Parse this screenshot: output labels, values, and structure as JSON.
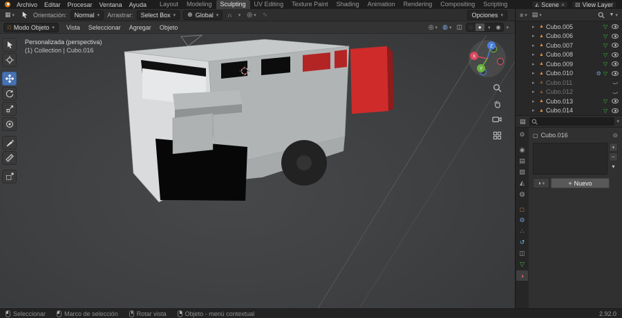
{
  "icons": {
    "chevron": "▾",
    "expand": "▸",
    "mesh_object": "▲",
    "mesh_data": "▽",
    "gear": "⚙",
    "magnet": "∩",
    "global_axis": "⊕",
    "prop_edit": "◎",
    "falloff": "∿",
    "menu": "≡",
    "editor_grid": "▦",
    "display_mode": "▤",
    "funnel": "▼",
    "gizmo_toggle": "◎",
    "overlays": "◍",
    "xray": "◫",
    "wireframe": "◌",
    "solid": "●",
    "matpreview": "◑",
    "rendered": "◉",
    "plus": "+",
    "minus": "−",
    "close": "×",
    "pin": "⊚",
    "cube": "▢",
    "scene_icon": "◭",
    "world_icon": "◍",
    "object_icon": "□",
    "render_icon": "◉",
    "output_icon": "▤",
    "viewlayer_icon": "▧",
    "particles_icon": "∴",
    "physics_icon": "↺",
    "constraints_icon": "◫",
    "material_icon": "◑",
    "sphere": "●"
  },
  "topbar": {
    "menus": [
      "Archivo",
      "Editar",
      "Procesar",
      "Ventana",
      "Ayuda"
    ],
    "workspaces": [
      "Layout",
      "Modeling",
      "Sculpting",
      "UV Editing",
      "Texture Paint",
      "Shading",
      "Animation",
      "Rendering",
      "Compositing",
      "Scripting"
    ],
    "active_workspace": "Sculpting",
    "scene_label": "Scene",
    "view_layer_label": "View Layer"
  },
  "tool_settings": {
    "orientation_label": "Orientación:",
    "orientation_value": "Normal",
    "drag_label": "Arrastrar:",
    "drag_value": "Select Box",
    "pivot_value": "Global",
    "options_label": "Opciones"
  },
  "viewport": {
    "mode": "Modo Objeto",
    "menus": [
      "Vista",
      "Seleccionar",
      "Agregar",
      "Objeto"
    ],
    "view_label": "Personalizada (perspectiva)",
    "context_label": "(1) Collection | Cubo.016"
  },
  "gizmo": {
    "x": "X",
    "y": "Y",
    "z": "Z"
  },
  "outliner": {
    "items": [
      {
        "name": "Cubo.005",
        "visible": true
      },
      {
        "name": "Cubo.006",
        "visible": true
      },
      {
        "name": "Cubo.007",
        "visible": true
      },
      {
        "name": "Cubo.008",
        "visible": true
      },
      {
        "name": "Cubo.009",
        "visible": true
      },
      {
        "name": "Cubo.010",
        "visible": true,
        "has_modifier": true
      },
      {
        "name": "Cubo.011",
        "visible": false
      },
      {
        "name": "Cubo.012",
        "visible": false
      },
      {
        "name": "Cubo.013",
        "visible": true
      },
      {
        "name": "Cubo.014",
        "visible": true
      }
    ]
  },
  "properties": {
    "breadcrumb_object": "Cubo.016",
    "new_button": "Nuevo",
    "active_tab": "material"
  },
  "statusbar": {
    "hint_select": "Seleccionar",
    "hint_box": "Marco de selección",
    "hint_rotate": "Rotar vista",
    "hint_context": "Objeto - menú contextual",
    "version": "2.92.0"
  },
  "colors": {
    "accent_blue": "#4772b3",
    "object_orange": "#e8913d",
    "data_green": "#3fbf3f",
    "door_red": "#cf2b2b",
    "axis_x": "#d9485e",
    "axis_y": "#69b33e",
    "axis_z": "#4a7fd6"
  }
}
